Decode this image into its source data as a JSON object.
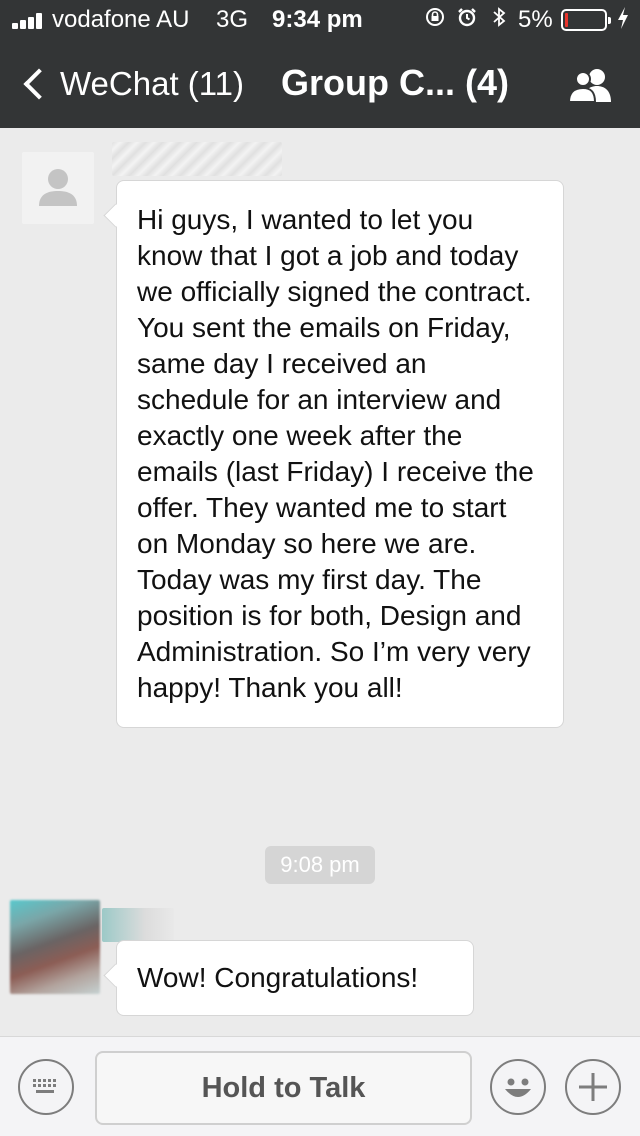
{
  "status_bar": {
    "carrier": "vodafone AU",
    "network": "3G",
    "time": "9:34 pm",
    "battery_percent": "5%",
    "battery_level": 0.05,
    "battery_color": "#e8352c",
    "icons": [
      "rotation-lock-icon",
      "alarm-icon",
      "bluetooth-icon",
      "charging-bolt-icon"
    ]
  },
  "nav": {
    "back_label": "WeChat (11)",
    "title": "Group C... (4)",
    "right_icon": "group-contacts-icon",
    "bg_color": "#333536"
  },
  "messages": [
    {
      "sender_avatar": "default-avatar-icon",
      "text": "Hi guys, I wanted to let you know that I got a job and today we officially signed the contract. You sent the emails on Friday, same day I received an schedule for an interview and exactly one week after the emails (last Friday) I receive the offer. They wanted me to start on Monday so here we are. Today was my first day. The position is for both, Design and Administration. So I’m very very happy! Thank you all!"
    },
    {
      "sender_avatar": "photo-avatar",
      "text": "Wow! Congratulations!"
    }
  ],
  "timestamp": "9:08 pm",
  "input_bar": {
    "hold_label": "Hold to Talk",
    "left_icon": "keyboard-icon",
    "emoji_icon": "emoji-icon",
    "plus_icon": "plus-icon"
  }
}
